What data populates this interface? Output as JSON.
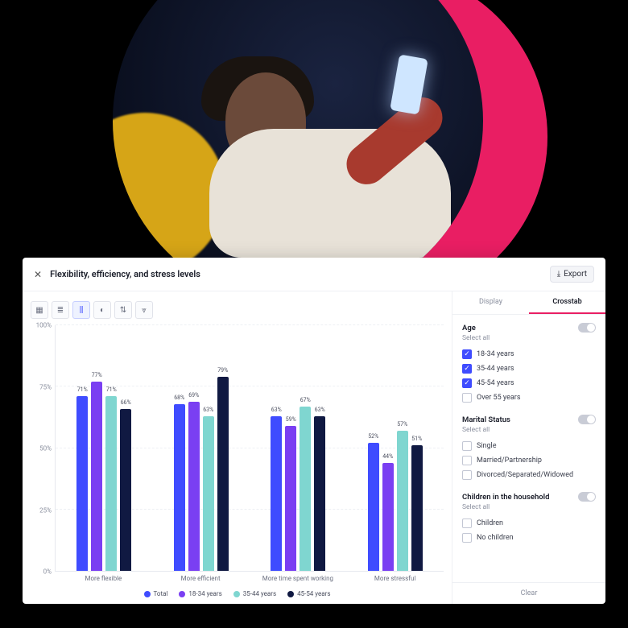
{
  "header": {
    "title": "Flexibility, efficiency, and stress levels",
    "export_label": "Export"
  },
  "toolbar": {
    "buttons": [
      "table",
      "hbar",
      "vbar",
      "pie",
      "sort",
      "line"
    ],
    "active_index": 2
  },
  "chart_data": {
    "type": "bar",
    "ylabel": "",
    "ylim": [
      0,
      100
    ],
    "yticks": [
      "0%",
      "25%",
      "50%",
      "75%",
      "100%"
    ],
    "categories": [
      "More flexible",
      "More efficient",
      "More time spent working",
      "More stressful"
    ],
    "series": [
      {
        "name": "Total",
        "color": "#3f4cff",
        "values": [
          71,
          68,
          63,
          52
        ]
      },
      {
        "name": "18-34 years",
        "color": "#7a3ff2",
        "values": [
          77,
          69,
          59,
          44
        ]
      },
      {
        "name": "35-44 years",
        "color": "#7fd6d0",
        "values": [
          71,
          63,
          67,
          57
        ]
      },
      {
        "name": "45-54 years",
        "color": "#101942",
        "values": [
          66,
          79,
          63,
          51
        ]
      }
    ]
  },
  "side": {
    "tabs": [
      "Display",
      "Crosstab"
    ],
    "active_tab": 1,
    "clear_label": "Clear",
    "groups": [
      {
        "title": "Age",
        "select_all": "Select all",
        "options": [
          {
            "label": "18-34 years",
            "checked": true
          },
          {
            "label": "35-44 years",
            "checked": true
          },
          {
            "label": "45-54 years",
            "checked": true
          },
          {
            "label": "Over 55 years",
            "checked": false
          }
        ]
      },
      {
        "title": "Marital Status",
        "select_all": "Select all",
        "options": [
          {
            "label": "Single",
            "checked": false
          },
          {
            "label": "Married/Partnership",
            "checked": false
          },
          {
            "label": "Divorced/Separated/Widowed",
            "checked": false
          }
        ]
      },
      {
        "title": "Children in the household",
        "select_all": "Select all",
        "options": [
          {
            "label": "Children",
            "checked": false
          },
          {
            "label": "No children",
            "checked": false
          }
        ]
      }
    ]
  }
}
